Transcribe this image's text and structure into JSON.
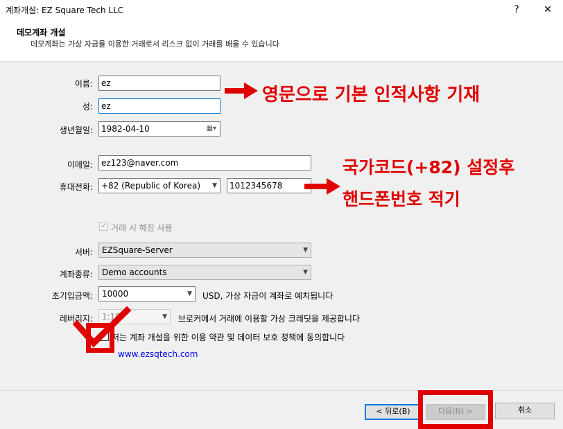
{
  "window": {
    "title": "계좌개설: EZ Square Tech LLC",
    "help": "?",
    "close": "✕"
  },
  "header": {
    "title": "데모계좌 개설",
    "description": "데모계좌는 가상 자금을 이용한 거래로서 리스크 없이 거래를 배울 수 있습니다"
  },
  "form": {
    "name_label": "이름:",
    "name_value": "ez",
    "surname_label": "성:",
    "surname_value": "ez",
    "birth_label": "생년월일:",
    "birth_value": "1982-04-10",
    "email_label": "이메일:",
    "email_value": "ez123@naver.com",
    "phone_label": "휴대전화:",
    "phone_country": "+82 (Republic of Korea)",
    "phone_number": "1012345678",
    "hedge_label": "거래 시 헤징 사용",
    "server_label": "서버:",
    "server_value": "EZSquare-Server",
    "account_type_label": "계좌종류:",
    "account_type_value": "Demo accounts",
    "deposit_label": "초기입금액:",
    "deposit_value": "10000",
    "deposit_note": "USD, 가상 자금이 계좌로 예치됩니다",
    "leverage_label": "레버리지:",
    "leverage_value": "1:10",
    "leverage_note": "브로커에서 거래에 이용할 가상 크레딧을 제공합니다",
    "agree_text": "저는 계좌 개설을 위한 이용 약관 및 데이터 보호 정책에 동의합니다",
    "website_link": "www.ezsqtech.com"
  },
  "buttons": {
    "back": "< 뒤로(B)",
    "next": "다음(N) >",
    "cancel": "취소"
  },
  "annotations": {
    "note1": "영문으로 기본 인적사항 기재",
    "note2_line1": "국가코드(+82) 설정후",
    "note2_line2": "핸드폰번호 적기"
  },
  "colors": {
    "annotation_red": "#e00000",
    "focus_blue": "#0078d7",
    "link_blue": "#0000ee"
  }
}
